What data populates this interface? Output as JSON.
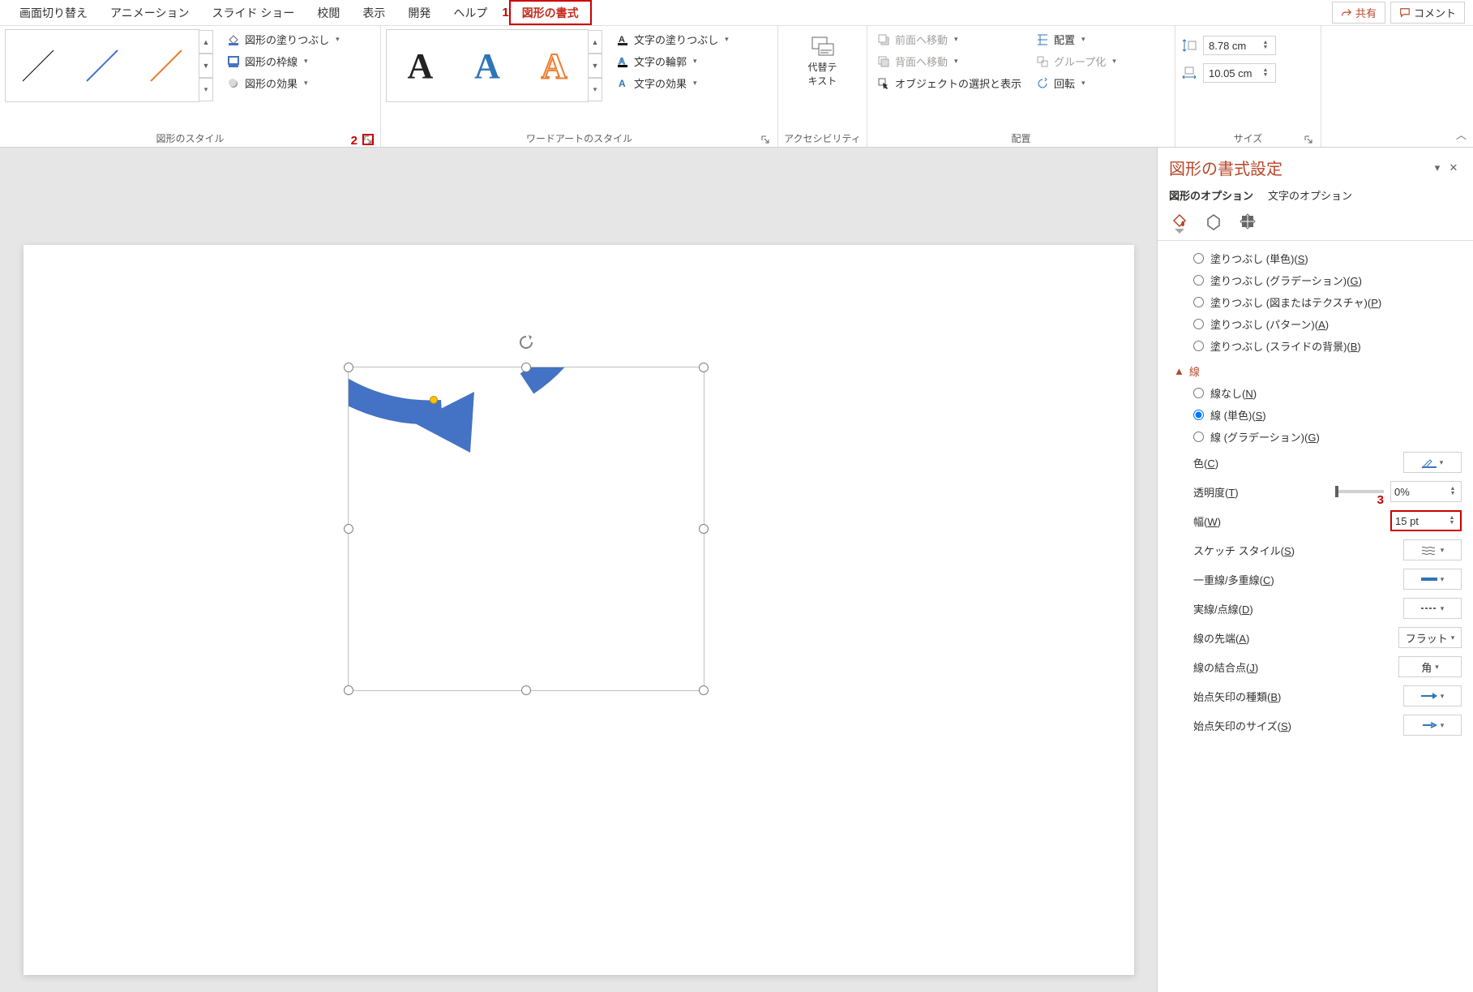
{
  "tabs": {
    "t0": "画面切り替え",
    "t1": "アニメーション",
    "t2": "スライド ショー",
    "t3": "校閲",
    "t4": "表示",
    "t5": "開発",
    "t6": "ヘルプ",
    "t7": "図形の書式"
  },
  "topButtons": {
    "share": "共有",
    "comment": "コメント"
  },
  "callouts": {
    "c1": "1",
    "c2": "2",
    "c3": "3"
  },
  "ribbon": {
    "shapeStyles": {
      "fill": "図形の塗りつぶし",
      "outline": "図形の枠線",
      "effects": "図形の効果",
      "label": "図形のスタイル"
    },
    "wordart": {
      "sampleA": "A",
      "textFill": "文字の塗りつぶし",
      "textOutline": "文字の輪郭",
      "textEffects": "文字の効果",
      "label": "ワードアートのスタイル"
    },
    "acc": {
      "altText1": "代替テ",
      "altText2": "キスト",
      "label": "アクセシビリティ"
    },
    "arrange": {
      "bringForward": "前面へ移動",
      "sendBackward": "背面へ移動",
      "selectionPane": "オブジェクトの選択と表示",
      "align": "配置",
      "group": "グループ化",
      "rotate": "回転",
      "label": "配置"
    },
    "size": {
      "height": "8.78 cm",
      "width": "10.05 cm",
      "label": "サイズ"
    }
  },
  "pane": {
    "title": "図形の書式設定",
    "tabShape": "図形のオプション",
    "tabText": "文字のオプション",
    "fill": {
      "solid": "塗りつぶし (単色)(",
      "solidK": "S",
      "solidEnd": ")",
      "grad": "塗りつぶし (グラデーション)(",
      "gradK": "G",
      "gradEnd": ")",
      "pic": "塗りつぶし (図またはテクスチャ)(",
      "picK": "P",
      "picEnd": ")",
      "pat": "塗りつぶし (パターン)(",
      "patK": "A",
      "patEnd": ")",
      "bg": "塗りつぶし (スライドの背景)(",
      "bgK": "B",
      "bgEnd": ")"
    },
    "line": {
      "head": "線",
      "none": "線なし(",
      "noneK": "N",
      "noneEnd": ")",
      "solid": "線 (単色)(",
      "solidK": "S",
      "solidEnd": ")",
      "grad": "線 (グラデーション)(",
      "gradK": "G",
      "gradEnd": ")",
      "color": "色(",
      "colorK": "C",
      "colorEnd": ")",
      "trans": "透明度(",
      "transK": "T",
      "transEnd": ")",
      "transVal": "0%",
      "width": "幅(",
      "widthK": "W",
      "widthEnd": ")",
      "widthVal": "15 pt",
      "sketch": "スケッチ スタイル(",
      "sketchK": "S",
      "sketchEnd": ")",
      "compound": "一重線/多重線(",
      "compoundK": "C",
      "compoundEnd": ")",
      "dash": "実線/点線(",
      "dashK": "D",
      "dashEnd": ")",
      "cap": "線の先端(",
      "capK": "A",
      "capEnd": ")",
      "capVal": "フラット",
      "join": "線の結合点(",
      "joinK": "J",
      "joinEnd": ")",
      "joinVal": "角",
      "beginArrow": "始点矢印の種類(",
      "beginArrowK": "B",
      "beginArrowEnd": ")",
      "beginSize": "始点矢印のサイズ(",
      "beginSizeK": "S",
      "beginSizeEnd": ")"
    }
  }
}
